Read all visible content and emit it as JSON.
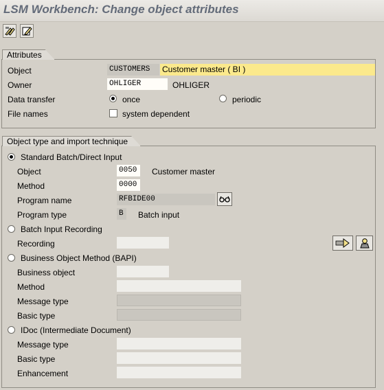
{
  "window": {
    "title": "LSM Workbench: Change object attributes"
  },
  "toolbar": {
    "buttons": [
      "display-change-icon",
      "edit-icon"
    ]
  },
  "attributes": {
    "group_title": "Attributes",
    "object_label": "Object",
    "object_value": "CUSTOMERS",
    "object_description": "Customer master ( BI )",
    "owner_label": "Owner",
    "owner_value": "OHLIGER",
    "owner_display": "OHLIGER",
    "data_transfer_label": "Data transfer",
    "data_transfer_options": [
      "once",
      "periodic"
    ],
    "data_transfer_selected": "once",
    "file_names_label": "File names",
    "system_dependent_label": "system dependent",
    "system_dependent_checked": false
  },
  "technique": {
    "group_title": "Object type and import technique",
    "selected": "Standard Batch/Direct Input",
    "standard": {
      "label": "Standard Batch/Direct Input",
      "object_label": "Object",
      "object_value": "0050",
      "object_desc": "Customer master",
      "method_label": "Method",
      "method_value": "0000",
      "program_name_label": "Program name",
      "program_name_value": "RFBIDE00",
      "program_type_label": "Program type",
      "program_type_value": "B",
      "program_type_desc": "Batch input"
    },
    "recording": {
      "label": "Batch Input Recording",
      "recording_label": "Recording"
    },
    "bapi": {
      "label": "Business Object Method (BAPI)",
      "business_object_label": "Business object",
      "method_label": "Method",
      "message_type_label": "Message type",
      "basic_type_label": "Basic type"
    },
    "idoc": {
      "label": "IDoc (Intermediate Document)",
      "message_type_label": "Message type",
      "basic_type_label": "Basic type",
      "enhancement_label": "Enhancement"
    }
  }
}
